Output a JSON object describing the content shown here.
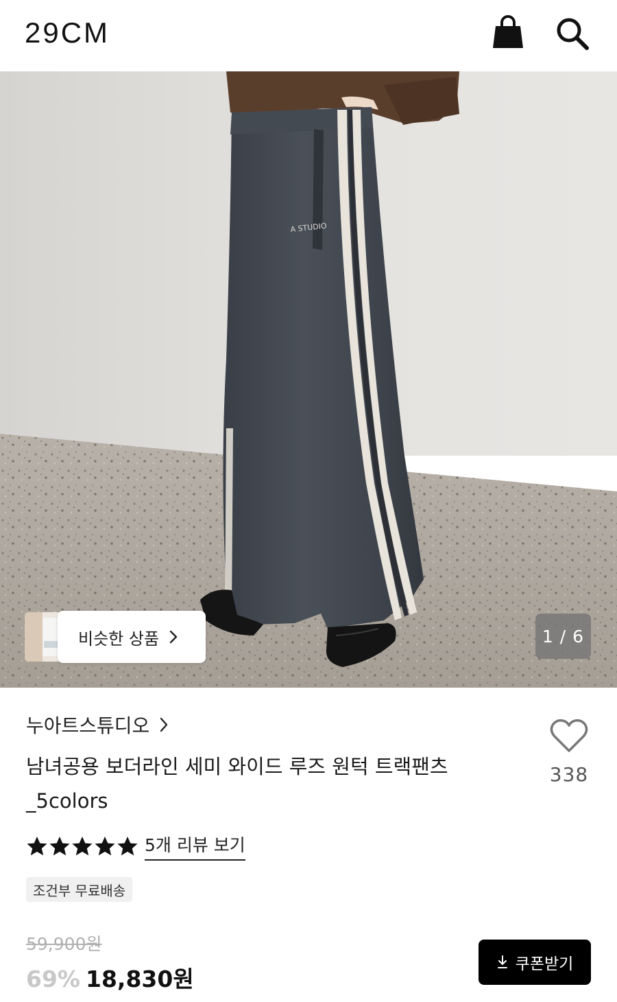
{
  "header": {
    "logo": "29CM",
    "bag_icon": "shopping-bag-icon",
    "search_icon": "search-icon"
  },
  "gallery": {
    "similar_label": "비슷한 상품",
    "counter": "1 / 6",
    "garment_text": "A STUDIO"
  },
  "product": {
    "brand": "누아트스튜디오",
    "title_line1": "남녀공용 보더라인 세미 와이드 루즈 원턱 트랙팬츠",
    "title_line2": "_5colors",
    "wish_count": "338",
    "rating_stars": 5,
    "review_link": "5개 리뷰 보기",
    "shipping_badge": "조건부 무료배송"
  },
  "price": {
    "original": "59,900원",
    "discount": "69%",
    "sale": "18,830원",
    "coupon_label": "쿠폰받기"
  },
  "colors": {
    "accent": "#000000",
    "discount": "#c8c8c8",
    "muted": "#b0b0b0"
  }
}
